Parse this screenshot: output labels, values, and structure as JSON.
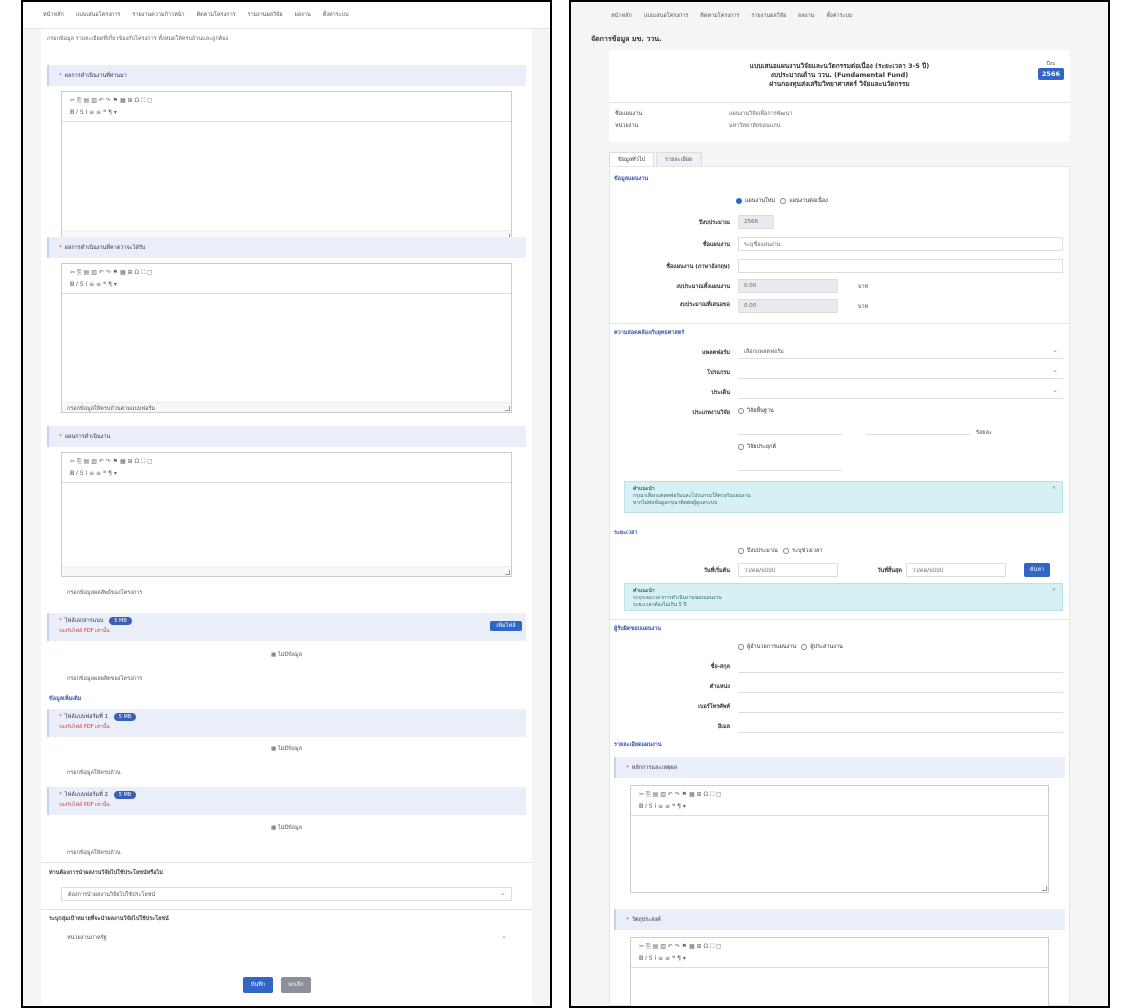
{
  "left": {
    "nav": [
      "หน้าหลัก",
      "แบบเสนอโครงการ",
      "รายงานความก้าวหน้า",
      "ติดตามโครงการ",
      "รายงานผลวิจัย",
      "ผลงาน",
      "ตั้งค่าระบบ"
    ],
    "intro_text": "กรอกข้อมูล รายละเอียดที่เกี่ยวข้องกับโครงการ ทั้งหมดให้ครบถ้วนและถูกต้อง",
    "field1_label": "ผลการดำเนินงานที่ผ่านมา",
    "field2_label": "ผลการดำเนินงานที่คาดว่าจะได้รับ",
    "note1": "กรอกข้อมูลให้ครบถ้วนตามแบบฟอร์ม",
    "field3_label": "แผนการดำเนินงาน",
    "note2": "กรอกข้อมูลผลลัพธ์ของโครงการ",
    "attach_label": "ไฟล์เอกสารแนบ",
    "attach_pill": "5 MB",
    "attach_hint": "รองรับไฟล์ PDF เท่านั้น",
    "attach_button": "เพิ่มไฟล์",
    "no_data_1": "ไม่มีข้อมูล",
    "note3": "กรอกข้อมูลผลผลิตของโครงการ",
    "section_label": "ข้อมูลเพิ่มเติม",
    "sub1_label": "ไฟล์แบบฟอร์มที่ 1",
    "sub1_pill": "5 MB",
    "sub1_hint": "รองรับไฟล์ PDF เท่านั้น",
    "no_data_2": "ไม่มีข้อมูล",
    "note4": "กรอกข้อมูลให้ครบถ้วน",
    "sub2_label": "ไฟล์แบบฟอร์มที่ 2",
    "sub2_pill": "5 MB",
    "sub2_hint": "รองรับไฟล์ PDF เท่านั้น",
    "no_data_3": "ไม่มีข้อมูล",
    "note5": "กรอกข้อมูลให้ครบถ้วน",
    "q1_label": "ท่านต้องการนำผลงานวิจัยไปใช้ประโยชน์หรือไม่",
    "q1_value": "ต้องการนำผลงานวิจัยไปใช้ประโยชน์",
    "q2_label": "ระบุกลุ่มเป้าหมายที่จะนำผลงานวิจัยไปใช้ประโยชน์",
    "q2_value": "หน่วยงานภาครัฐ",
    "save_button": "บันทึก",
    "cancel_button": "ยกเลิก"
  },
  "right": {
    "nav": [
      "หน้าหลัก",
      "แบบเสนอโครงการ",
      "ติดตามโครงการ",
      "รายงานผลวิจัย",
      "ผลงาน",
      "ตั้งค่าระบบ"
    ],
    "breadcrumb": "จัดการข้อมูล มข. ววน.",
    "title_line1": "แบบเสนอแผนงานวิจัยและนวัตกรรมต่อเนื่อง (ระยะเวลา 3-5 ปี)",
    "title_line2": "งบประมาณด้าน ววน. (Fundamental Fund)",
    "title_line3": "ผ่านกองทุนส่งเสริมวิทยาศาสตร์ วิจัยและนวัตกรรม",
    "year_label": "ปีงบ",
    "year_value": "2566",
    "info1_key": "ชื่อแผนงาน",
    "info1_value": "แผนงานวิจัยเพื่อการพัฒนา",
    "info2_key": "หน่วยงาน",
    "info2_value": "มหาวิทยาลัยขอนแก่น",
    "tab1": "ข้อมูลทั่วไป",
    "tab2": "รายละเอียด",
    "sec1_title": "ข้อมูลแผนงาน",
    "radio_a": "แผนงานใหม่",
    "radio_b": "แผนงานต่อเนื่อง",
    "f_year_label": "ปีงบประมาณ",
    "f_year_value": "2566",
    "f_name_label": "ชื่อแผนงาน",
    "f_name_value": "ระบุชื่อแผนงาน",
    "f_name_en_label": "ชื่อแผนงาน (ภาษาอังกฤษ)",
    "f_budget_label": "งบประมาณทั้งแผนงาน",
    "f_budget_value": "0.00",
    "f_budget_unit": "บาท",
    "f_budget2_label": "งบประมาณที่เสนอขอ",
    "f_budget2_value": "0.00",
    "f_budget2_unit": "บาท",
    "sec2_title": "ความสอดคล้องกับยุทธศาสตร์",
    "s_platform_label": "แพลตฟอร์ม",
    "s_platform_value": "เลือกแพลตฟอร์ม",
    "s_program_label": "โปรแกรม",
    "s_key_label": "ประเด็น",
    "s_type_label": "ประเภทงานวิจัย",
    "s_type_opt1": "วิจัยพื้นฐาน",
    "s_type_unit": "ร้อยละ",
    "s_type_opt2": "วิจัยประยุกต์",
    "alert1_title": "คำแนะนำ",
    "alert1_line1": "กรุณาเลือกแพลตฟอร์มและโปรแกรมให้ตรงกับแผนงาน",
    "alert1_line2": "หากไม่พบข้อมูลกรุณาติดต่อผู้ดูแลระบบ",
    "sec3_title": "ระยะเวลา",
    "r_opt1": "ปีงบประมาณ",
    "r_opt2": "ระบุช่วงเวลา",
    "start_label": "วันที่เริ่มต้น",
    "start_value": "วว/ดด/ปปปป",
    "end_label": "วันที่สิ้นสุด",
    "end_value": "วว/ดด/ปปปป",
    "search_button": "ค้นหา",
    "alert2_title": "คำแนะนำ",
    "alert2_line1": "ระบุระยะเวลาการดำเนินงานของแผนงาน",
    "alert2_line2": "ระยะเวลาต้องไม่เกิน 5 ปี",
    "sec4_title": "ผู้รับผิดชอบแผนงาน",
    "p_opt1": "ผู้อำนวยการแผนงาน",
    "p_opt2": "ผู้ประสานงาน",
    "p_name": "ชื่อ-สกุล",
    "p_pos": "ตำแหน่ง",
    "p_phone": "เบอร์โทรศัพท์",
    "p_email": "อีเมล",
    "sec5_title": "รายละเอียดแผนงาน",
    "e1_label": "หลักการและเหตุผล",
    "e2_label": "วัตถุประสงค์"
  }
}
